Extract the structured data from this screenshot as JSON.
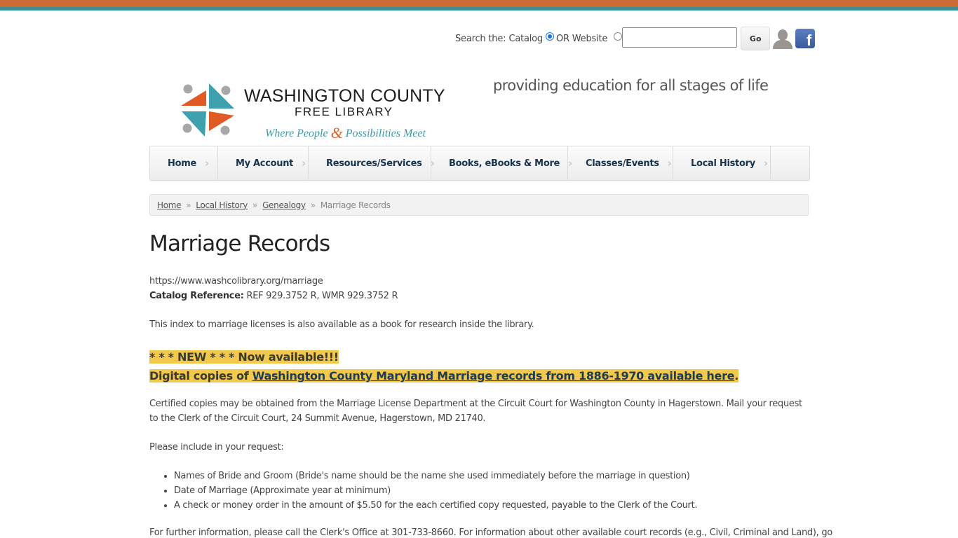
{
  "colors": {
    "top_bar_orange": "#cd6a35",
    "top_bar_teal": "#3a9193",
    "nav_text": "#17344e",
    "highlight": "#f2c94c",
    "logo_teal": "#3d9aa6",
    "logo_orange": "#d9622b"
  },
  "search": {
    "label": "Search the:",
    "option_catalog": "Catalog",
    "option_website": "OR Website",
    "selected": "Catalog",
    "input_value": "",
    "go_label": "Go"
  },
  "header_icons": {
    "account": "user-silhouette-icon",
    "facebook": "facebook-icon",
    "facebook_glyph": "f"
  },
  "logo": {
    "line1": "WASHINGTON COUNTY",
    "line2": "FREE LIBRARY",
    "tag_part1": "Where People",
    "tag_amp": "&",
    "tag_part2": "Possibilities Meet"
  },
  "tagline": "providing education for all stages of life",
  "nav": {
    "items": [
      {
        "label": "Home"
      },
      {
        "label": "My Account"
      },
      {
        "label": "Resources/Services"
      },
      {
        "label": "Books, eBooks & More"
      },
      {
        "label": "Classes/Events"
      },
      {
        "label": "Local History"
      }
    ],
    "chevron": "›"
  },
  "breadcrumb": {
    "items": [
      "Home",
      "Local History",
      "Genealogy"
    ],
    "current": "Marriage Records",
    "separator": "»"
  },
  "main": {
    "title": "Marriage Records",
    "url": "https://www.washcolibrary.org/marriage",
    "catalog_ref_label": "Catalog Reference:",
    "catalog_ref_value": "REF 929.3752 R, WMR 929.3752 R",
    "index_note": "This index to marriage licenses is also available as a book for research inside the library.",
    "new_banner": "* * * NEW * * * Now available!!!",
    "digital_prefix": "Digital copies of ",
    "digital_link": "Washington County Maryland Marriage records from 1886-1970 available here",
    "digital_suffix": ".",
    "certified_text": "Certified copies may be obtained from the Marriage License Department at the Circuit Court for Washington County in Hagerstown. Mail your request to the Clerk of the Circuit Court, 24 Summit Avenue, Hagerstown, MD 21740.",
    "include_intro": "Please include in your request:",
    "requirements": [
      "Names of Bride and Groom (Bride's name should be the name she used immediately before the marriage in question)",
      "Date of Marriage (Approximate year at minimum)",
      "A check or money order in the amount of $5.50 for the each certified copy requested, payable to the Clerk of the Court."
    ],
    "further_info": "For further information, please call the Clerk's Office at 301-733-8660. For information about other available court records (e.g., Civil, Criminal and Land), go"
  }
}
